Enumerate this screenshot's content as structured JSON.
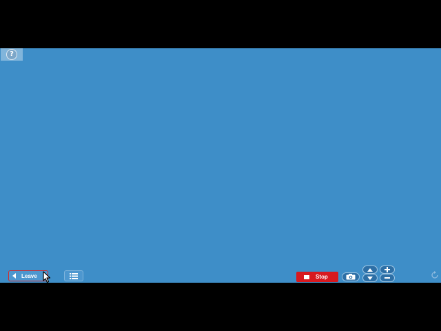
{
  "stage": {
    "background_color": "#3e8ec8"
  },
  "help": {
    "label": "?",
    "icon": "help-icon"
  },
  "leave": {
    "label": "Leave",
    "icon": "left-arrow-icon"
  },
  "list": {
    "icon": "list-icon"
  },
  "stop": {
    "label": "Stop",
    "icon": "stop-square-icon",
    "color": "#d7191f"
  },
  "camera": {
    "icon": "camera-icon"
  },
  "zoom": {
    "up_icon": "chevron-up-icon",
    "down_icon": "chevron-down-icon",
    "plus_icon": "plus-icon",
    "minus_icon": "minus-icon"
  },
  "corner": {
    "icon": "rotate-icon"
  },
  "pointer": {
    "icon": "mouse-pointer-icon"
  }
}
